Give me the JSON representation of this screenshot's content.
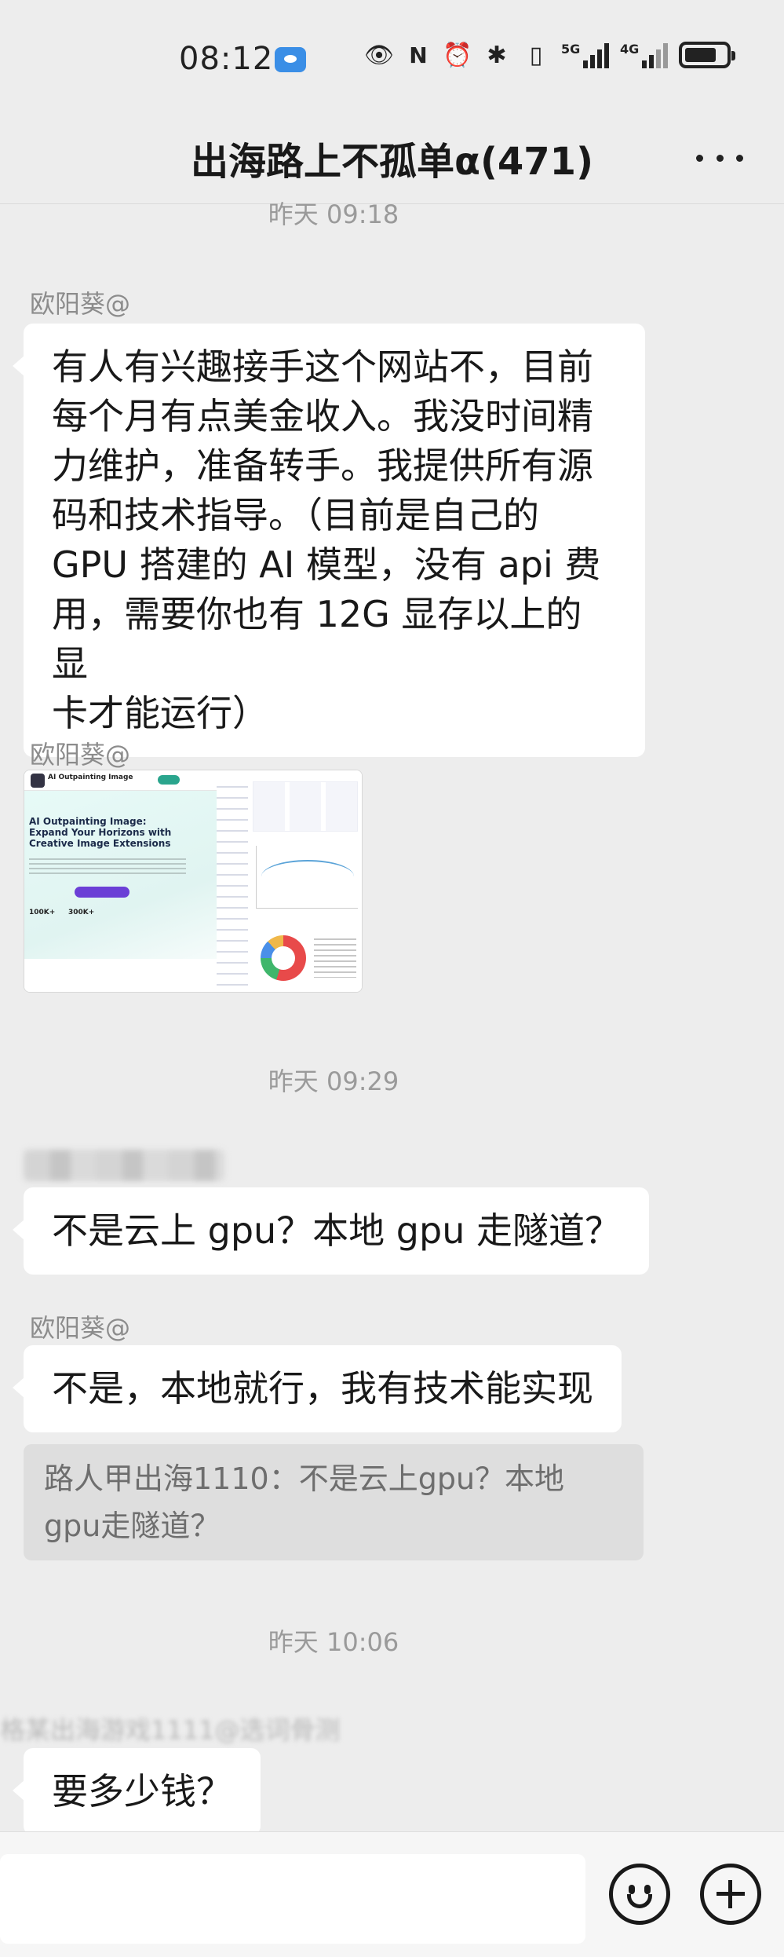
{
  "status_bar": {
    "time": "08:12",
    "network_1": "5G",
    "network_2": "4G"
  },
  "header": {
    "title": "出海路上不孤单α(471)",
    "more_icon": "more-horizontal-icon"
  },
  "messages": [
    {
      "type": "timestamp",
      "text": "昨天 09:18"
    },
    {
      "type": "text",
      "sender": "欧阳葵@",
      "lines": [
        "有人有兴趣接手这个网站不，目前",
        "每个月有点美金收入。我没时间精",
        "力维护，准备转手。我提供所有源",
        "码和技术指导。（目前是自己的",
        "GPU 搭建的 AI 模型，没有 api 费",
        "用，需要你也有 12G 显存以上的显",
        "卡才能运行）"
      ]
    },
    {
      "type": "image",
      "sender": "欧阳葵@",
      "preview_title": "AI Outpainting Image: Expand Your Horizons with Creative Image Extensions",
      "preview_brand": "AI Outpainting Image",
      "stat_1": "100K+",
      "stat_2": "300K+"
    },
    {
      "type": "timestamp",
      "text": "昨天 09:29"
    },
    {
      "type": "text",
      "sender": "",
      "lines": [
        "不是云上 gpu？本地 gpu 走隧道？"
      ]
    },
    {
      "type": "text",
      "sender": "欧阳葵@",
      "lines": [
        "不是，本地就行，我有技术能实现"
      ],
      "quote_lines": [
        "路人甲出海1110：不是云上gpu？本地",
        "gpu走隧道？"
      ]
    },
    {
      "type": "timestamp",
      "text": "昨天 10:06"
    },
    {
      "type": "text",
      "sender": "格某出海游戏1111@选词骨测",
      "lines": [
        "要多少钱？"
      ]
    }
  ],
  "input_bar": {
    "emoji_icon": "emoji-smile-icon",
    "plus_icon": "plus-circle-icon"
  }
}
